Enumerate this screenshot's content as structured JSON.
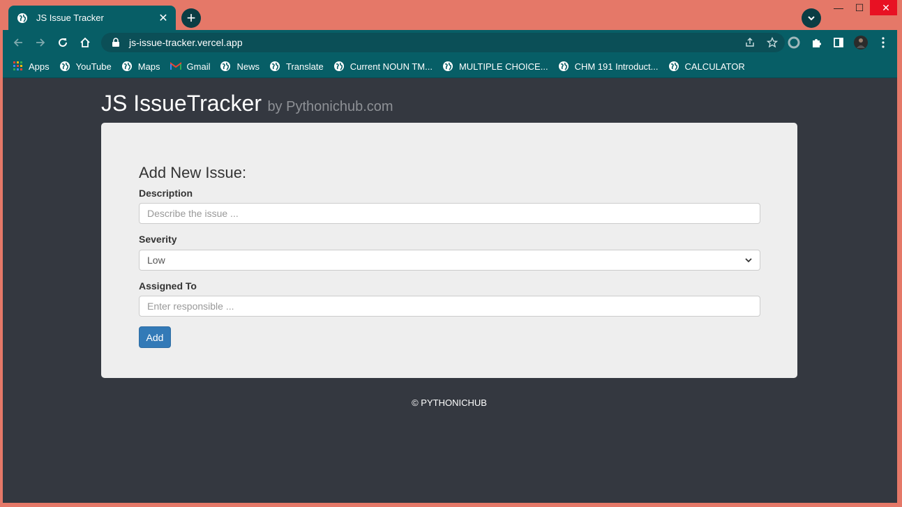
{
  "browser": {
    "tab": {
      "title": "JS Issue Tracker",
      "close": "✕"
    },
    "new_tab": "+",
    "window_controls": {
      "minimize": "—",
      "maximize": "☐",
      "close": "✕"
    },
    "url": "js-issue-tracker.vercel.app",
    "bookmarks": [
      {
        "label": "Apps",
        "icon": "apps-grid-icon"
      },
      {
        "label": "YouTube",
        "icon": "globe-icon"
      },
      {
        "label": "Maps",
        "icon": "globe-icon"
      },
      {
        "label": "Gmail",
        "icon": "gmail-icon"
      },
      {
        "label": "News",
        "icon": "globe-icon"
      },
      {
        "label": "Translate",
        "icon": "globe-icon"
      },
      {
        "label": "Current NOUN TM...",
        "icon": "globe-icon"
      },
      {
        "label": "MULTIPLE CHOICE...",
        "icon": "globe-icon"
      },
      {
        "label": "CHM 191 Introduct...",
        "icon": "globe-icon"
      },
      {
        "label": "CALCULATOR",
        "icon": "globe-icon"
      }
    ]
  },
  "page": {
    "title": "JS IssueTracker",
    "subtitle": "by Pythonichub.com",
    "form": {
      "heading": "Add New Issue:",
      "description_label": "Description",
      "description_placeholder": "Describe the issue ...",
      "severity_label": "Severity",
      "severity_value": "Low",
      "assigned_label": "Assigned To",
      "assigned_placeholder": "Enter responsible ...",
      "add_label": "Add"
    },
    "footer": "© PYTHONICHUB"
  },
  "colors": {
    "frame": "#e57868",
    "chrome": "#075e66",
    "page_bg": "#343840",
    "panel_bg": "#eeeeee",
    "button": "#337ab7"
  }
}
